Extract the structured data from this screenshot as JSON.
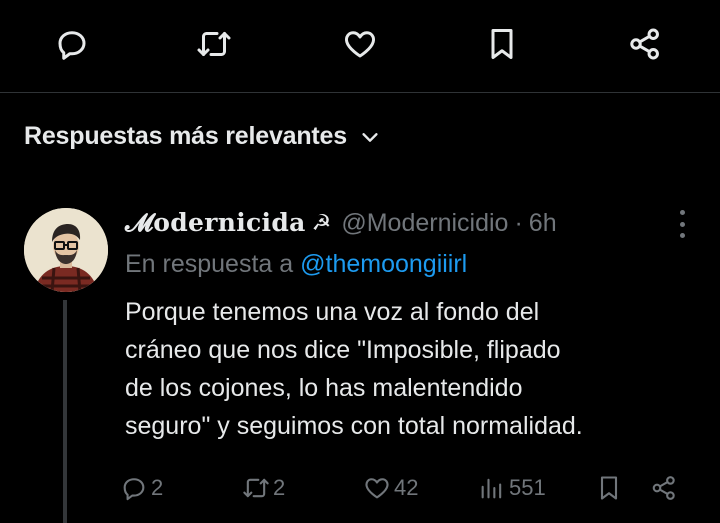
{
  "toolbar": {
    "icons": [
      "reply-icon",
      "repost-icon",
      "like-icon",
      "bookmark-icon",
      "share-icon"
    ]
  },
  "sort": {
    "label": "Respuestas más relevantes"
  },
  "reply": {
    "display_name": "𝓜odernicida",
    "emoji": "☭",
    "handle": "@Modernicidio",
    "time": "6h",
    "reply_prefix": "En respuesta a",
    "reply_to": "@themoongiiirl",
    "text_lines": [
      "Porque tenemos una voz al fondo del",
      "cráneo que nos dice \"Imposible, flipado",
      "de los cojones, lo has malentendido",
      "seguro\" y seguimos con total normalidad."
    ],
    "counts": {
      "replies": "2",
      "reposts": "2",
      "likes": "42",
      "views": "551"
    }
  },
  "colors": {
    "background": "#000000",
    "text": "#e7e9ea",
    "muted": "#71767b",
    "link": "#1d9bf0",
    "divider": "#2f3336"
  }
}
